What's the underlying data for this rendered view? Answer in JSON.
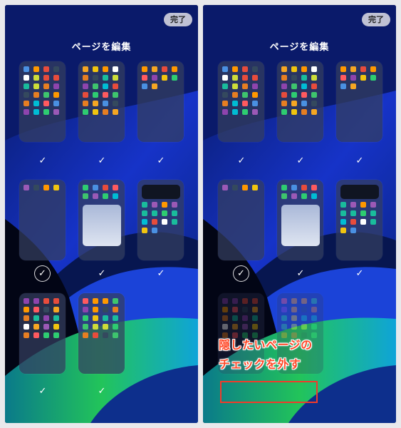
{
  "header": {
    "done_label": "完了",
    "title": "ページを編集"
  },
  "annotation": {
    "line1": "隠したいページの",
    "line2": "チェックを外す"
  },
  "check_glyph": "✓",
  "colors": {
    "accent_red": "#f23a2a",
    "annotation_text": "#ff4a2a",
    "background": "#05103a"
  },
  "panels": [
    {
      "side": "left",
      "pages": [
        {
          "checked": true,
          "kind": "icons"
        },
        {
          "checked": true,
          "kind": "icons"
        },
        {
          "checked": true,
          "kind": "icons"
        },
        {
          "checked": false,
          "kind": "icons"
        },
        {
          "checked": true,
          "kind": "widget-icons"
        },
        {
          "checked": true,
          "kind": "icons"
        },
        {
          "checked": true,
          "kind": "icons"
        },
        {
          "checked": true,
          "kind": "icons"
        }
      ]
    },
    {
      "side": "right",
      "pages": [
        {
          "checked": true,
          "kind": "icons"
        },
        {
          "checked": true,
          "kind": "icons"
        },
        {
          "checked": true,
          "kind": "icons"
        },
        {
          "checked": false,
          "kind": "icons"
        },
        {
          "checked": true,
          "kind": "widget-icons"
        },
        {
          "checked": true,
          "kind": "icons"
        },
        {
          "checked": false,
          "kind": "icons"
        },
        {
          "checked": false,
          "kind": "icons"
        }
      ]
    }
  ]
}
